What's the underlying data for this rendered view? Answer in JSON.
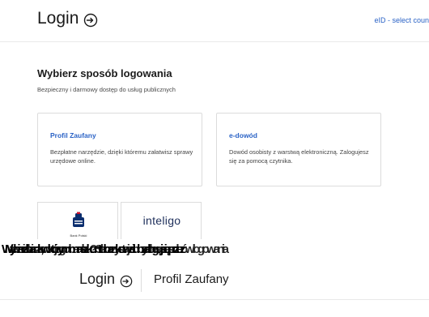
{
  "header": {
    "title": "Login",
    "eid_link": "eID - select coun"
  },
  "main": {
    "heading": "Wybierz sposób logowania",
    "subheading": "Bezpieczny i darmowy dostęp do usług publicznych",
    "cards": [
      {
        "title": "Profil Zaufany",
        "description": "Bezpłatne narzędzie, dzięki któremu załatwisz sprawy urzędowe online."
      },
      {
        "title": "e-dowód",
        "description": "Dowód osobisty z warstwą elektroniczną. Zalogujesz się za pomocą czytnika."
      }
    ],
    "banks": [
      {
        "name": "Bank Polski"
      },
      {
        "name": "inteligo"
      }
    ]
  },
  "overlay": {
    "garbled_line_1": "Wybierz bank, w którym masz konto bankowe lub zaloguj się przez",
    "garbled_line_2": "Nie widzisz swojego banku? Skorzystaj z innych sposobów logowania"
  },
  "footer_header": {
    "title": "Login",
    "service": "Profil Zaufany"
  },
  "colors": {
    "accent": "#2b63c6",
    "text": "#1b1b1b",
    "border": "#dcdcdc"
  }
}
